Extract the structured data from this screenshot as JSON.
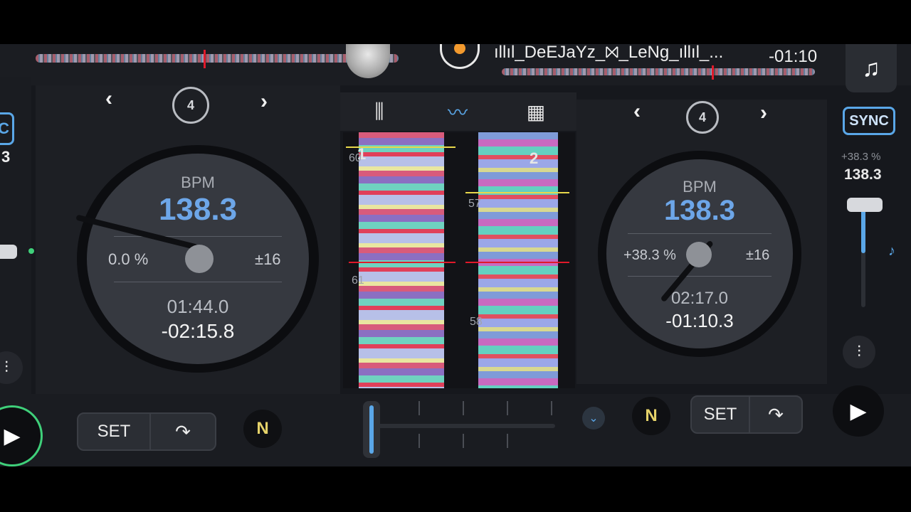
{
  "top": {
    "track_title": "ıllıl_DeEJaYz_⨝_LeNg_ıllıl_...",
    "remaining": "-01:10",
    "music_icon": "music-note-icon"
  },
  "deck_left": {
    "edge_sync_partial": "C",
    "edge_digit": "3",
    "prev": "‹",
    "next": "›",
    "loop_beats": "4",
    "bpm_label": "BPM",
    "bpm": "138.3",
    "pitch": "0.0 %",
    "range": "±16",
    "elapsed": "01:44.0",
    "remaining": "-02:15.8"
  },
  "deck_right": {
    "prev": "‹",
    "next": "›",
    "loop_beats": "4",
    "bpm_label": "BPM",
    "bpm": "138.3",
    "pitch": "+38.3 %",
    "range": "±16",
    "elapsed": "02:17.0",
    "remaining": "-01:10.3"
  },
  "center": {
    "tabs": [
      {
        "icon": "mixer-icon"
      },
      {
        "icon": "waveform-icon",
        "active": true
      },
      {
        "icon": "grid-icon"
      }
    ],
    "deck1_label": "1",
    "deck2_label": "2",
    "beat_labels_left": [
      "60",
      "61"
    ],
    "beat_labels_right": [
      "57",
      "58"
    ]
  },
  "right_fader": {
    "sync": "SYNC",
    "pitch_percent": "+38.3 %",
    "bpm": "138.3"
  },
  "bottom": {
    "set_label": "SET",
    "n_label": "N"
  },
  "colors": {
    "accent": "#5aa7e8",
    "play_ring": "#3fd07a",
    "playhead": "#e0192a"
  }
}
